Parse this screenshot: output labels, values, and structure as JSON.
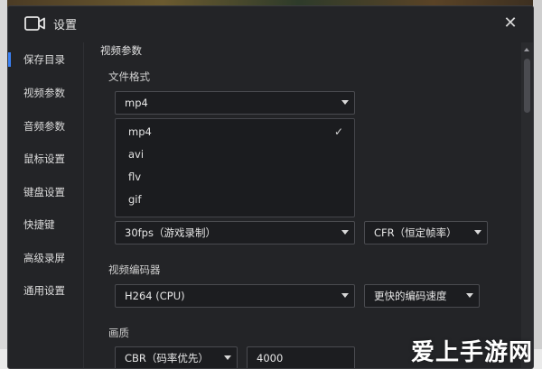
{
  "window": {
    "title": "设置",
    "close_glyph": "✕"
  },
  "sidebar": {
    "items": [
      {
        "label": "保存目录",
        "active": true
      },
      {
        "label": "视频参数"
      },
      {
        "label": "音频参数"
      },
      {
        "label": "鼠标设置"
      },
      {
        "label": "键盘设置"
      },
      {
        "label": "快捷键"
      },
      {
        "label": "高级录屏"
      },
      {
        "label": "通用设置"
      }
    ]
  },
  "main": {
    "section_title": "视频参数",
    "file_format": {
      "label": "文件格式",
      "value": "mp4",
      "options": [
        "mp4",
        "avi",
        "flv",
        "gif"
      ],
      "selected": "mp4"
    },
    "framerate": {
      "value": "30fps（游戏录制）",
      "mode": "CFR（恒定帧率）"
    },
    "encoder": {
      "label": "视频编码器",
      "value": "H264 (CPU)",
      "preset": "更快的编码速度"
    },
    "quality": {
      "label": "画质",
      "rate_control": "CBR（码率优先）",
      "bitrate": "4000"
    }
  },
  "watermark": "爱上手游网",
  "colors": {
    "accent": "#3b82f6",
    "window_bg": "#232427",
    "field_bg": "#1c1d20"
  },
  "icons": {
    "app": "camera-icon",
    "close": "close-icon",
    "check": "checkmark-icon",
    "dropdown": "chevron-down-icon"
  }
}
